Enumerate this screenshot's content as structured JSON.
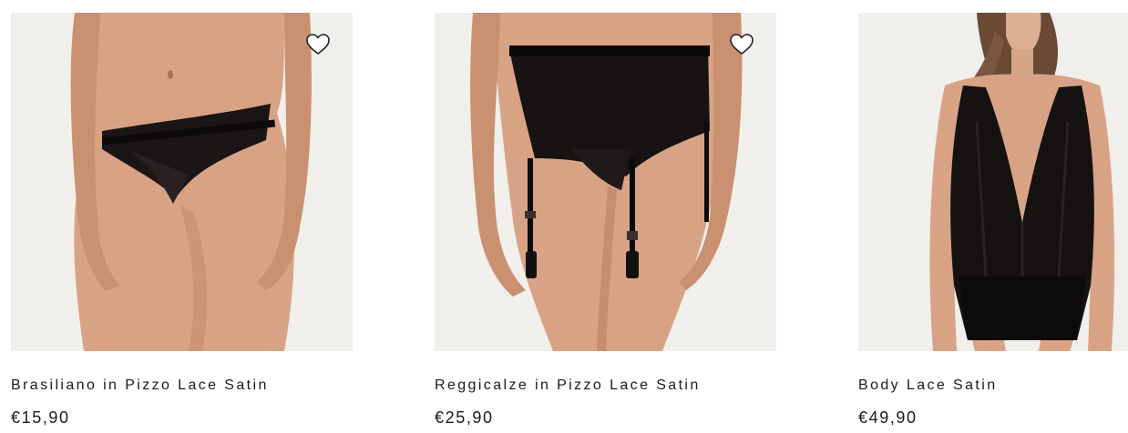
{
  "products": [
    {
      "name": "Brasiliano in Pizzo Lace Satin",
      "price": "€15,90",
      "wishlist_icon": "heart-outline-icon",
      "has_wishlist": true
    },
    {
      "name": "Reggicalze in Pizzo Lace Satin",
      "price": "€25,90",
      "wishlist_icon": "heart-outline-icon",
      "has_wishlist": true
    },
    {
      "name": "Body Lace Satin",
      "price": "€49,90",
      "has_wishlist": false
    }
  ],
  "colors": {
    "image_background": "#f1efec",
    "skin": "#d9a88a",
    "garment": "#141212",
    "text": "#1a1a1a"
  }
}
